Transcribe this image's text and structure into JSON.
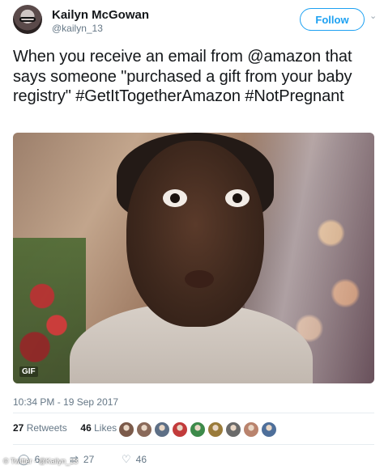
{
  "user": {
    "name": "Kailyn McGowan",
    "handle": "@kailyn_13"
  },
  "follow_label": "Follow",
  "tweet": {
    "text": "When you receive an email from @amazon that says someone \"purchased a gift from your baby registry\" #GetItTogetherAmazon #NotPregnant",
    "media_badge": "GIF"
  },
  "timestamp": "10:34 PM - 19 Sep 2017",
  "stats": {
    "retweets_count": "27",
    "retweets_label": "Retweets",
    "likes_count": "46",
    "likes_label": "Likes"
  },
  "likers": [
    {
      "color": "#7b5a4a"
    },
    {
      "color": "#8a6a5a"
    },
    {
      "color": "#5d6f86"
    },
    {
      "color": "#c23b3b"
    },
    {
      "color": "#3d8a4a"
    },
    {
      "color": "#9a7b3a"
    },
    {
      "color": "#6a6a6a"
    },
    {
      "color": "#b9836d"
    },
    {
      "color": "#4e6f9a"
    }
  ],
  "actions": {
    "reply_count": "6",
    "retweet_count": "27",
    "like_count": "46"
  },
  "icons": {
    "reply": "reply-icon",
    "retweet": "retweet-icon",
    "like": "heart-icon",
    "dropdown": "chevron-down-icon"
  },
  "watermark": "© Twitter - @Kailyn_13",
  "colors": {
    "accent": "#1da1f2",
    "text": "#14171a",
    "muted": "#657786"
  }
}
